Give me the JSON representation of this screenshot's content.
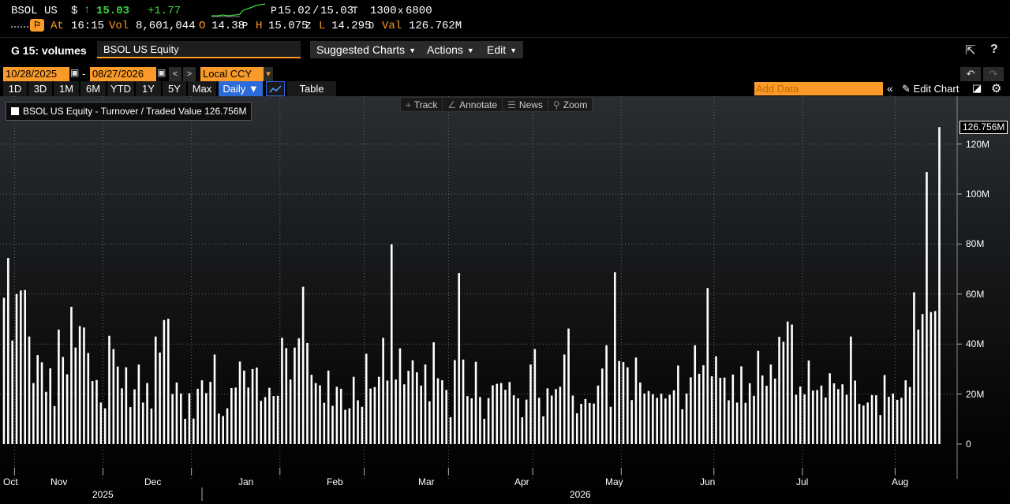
{
  "quote": {
    "ticker": "BSOL US",
    "currency": "$",
    "arrow": "↑",
    "last": "15.03",
    "change": "+1.77",
    "bid_prefix": "P",
    "bid": "15.02",
    "slash": "/",
    "ask": "15.03",
    "ask_suffix": "T",
    "size_bid": "1300",
    "size_x": "x",
    "size_ask": "6800",
    "at_label": "At",
    "time": "16:15",
    "vol_label": "Vol",
    "volume": "8,601,044",
    "open_label": "O",
    "open": "14.38",
    "open_suffix": "P",
    "high_label": "H",
    "high": "15.075",
    "high_suffix": "Z",
    "low_label": "L",
    "low": "14.295",
    "low_suffix": "D",
    "val_label": "Val",
    "value": "126.762M"
  },
  "toolbar": {
    "title": "G 15: volumes",
    "security": "BSOL US Equity",
    "suggested": "Suggested Charts",
    "actions": "Actions",
    "edit": "Edit"
  },
  "range": {
    "start": "10/28/2025",
    "dash": "-",
    "end": "08/27/2026",
    "currency": "Local CCY"
  },
  "periods": [
    "1D",
    "3D",
    "1M",
    "6M",
    "YTD",
    "1Y",
    "5Y",
    "Max"
  ],
  "frequency": "Daily ▼",
  "table_label": "Table",
  "add_data_placeholder": "Add Data",
  "edit_chart": "Edit Chart",
  "tools": {
    "track": "Track",
    "annotate": "Annotate",
    "news": "News",
    "zoom": "Zoom"
  },
  "legend_text": "BSOL US Equity - Turnover / Traded Value 126.756M",
  "last_value_label": "126.756M",
  "chart_data": {
    "type": "bar",
    "title": "",
    "series": [
      {
        "name": "BSOL US Equity - Turnover / Traded Value",
        "color": "#ffffff"
      }
    ],
    "y_ticks": [
      "0",
      "20M",
      "40M",
      "60M",
      "80M",
      "100M",
      "120M"
    ],
    "ylim": [
      0,
      130
    ],
    "y_unit": "M",
    "x_labels": [
      "Oct",
      "Nov",
      "Dec",
      "Jan",
      "Feb",
      "Mar",
      "Apr",
      "May",
      "Jun",
      "Jul",
      "Aug"
    ],
    "year_labels": [
      "2025",
      "2026"
    ],
    "grid": true,
    "values": [
      58.5,
      74.4,
      41.4,
      60,
      61.4,
      61.6,
      43,
      24.4,
      35.6,
      32.7,
      20.9,
      30.3,
      15.2,
      45.8,
      34.8,
      27.9,
      54.9,
      38.6,
      47.2,
      46.6,
      36.4,
      25.2,
      25.6,
      16.6,
      14.3,
      43.3,
      38,
      31,
      22.3,
      30.7,
      14.8,
      21.9,
      31.8,
      16.6,
      24.4,
      14.2,
      43,
      36.6,
      49.6,
      50.1,
      20,
      24.6,
      20.2,
      10.1,
      20.3,
      10.2,
      22.1,
      25.5,
      20.4,
      24.9,
      35.8,
      12.2,
      11.2,
      14.3,
      22.4,
      22.6,
      33,
      29.4,
      22.6,
      30,
      30.6,
      17.3,
      18.8,
      22.5,
      19.2,
      19.3,
      42.5,
      38.4,
      25.8,
      38.6,
      42.3,
      62.9,
      40.4,
      27.7,
      24.4,
      23.5,
      16.5,
      29.4,
      15.3,
      22.9,
      22.1,
      13.7,
      14.3,
      26.9,
      17.5,
      14.9,
      36.1,
      22.2,
      22.8,
      26.9,
      42.5,
      25.4,
      79.9,
      25.8,
      38.3,
      23.9,
      29.3,
      33.5,
      28.7,
      23.4,
      31.8,
      17.1,
      40.7,
      26.3,
      25.5,
      21.6,
      10.7,
      33.6,
      68.4,
      33.8,
      19.2,
      18.3,
      32.9,
      18.8,
      10.1,
      18.4,
      23.5,
      24.1,
      24.4,
      21.7,
      24.8,
      19.5,
      18.3,
      10.7,
      17.8,
      31.8,
      38,
      18.5,
      11.1,
      22.3,
      19.4,
      22,
      22.9,
      35.8,
      46.2,
      19.4,
      12.3,
      16.1,
      18,
      16.4,
      16.2,
      23.4,
      30.2,
      39.5,
      14.9,
      68.7,
      33.2,
      32.8,
      30.7,
      17.6,
      34.6,
      24.6,
      20.2,
      21.2,
      19.9,
      18.5,
      20.1,
      18.2,
      19.7,
      21.5,
      31.4,
      13.9,
      20.2,
      26.7,
      39.5,
      28.1,
      31.5,
      62.4,
      27.1,
      35.1,
      26.5,
      26.6,
      17.5,
      27.8,
      16.6,
      31.1,
      16.5,
      24.3,
      19.3,
      37.3,
      27.4,
      23.3,
      31.8,
      26.2,
      42.9,
      40.9,
      49,
      47.8,
      19.7,
      23,
      19.9,
      33.4,
      21.4,
      21.6,
      23.4,
      18.6,
      28.3,
      24.3,
      22,
      23.9,
      19.7,
      43,
      25.4,
      16.1,
      15.4,
      16.6,
      19.6,
      19.5,
      11.6,
      27.6,
      18.9,
      20.2,
      17.7,
      18.5,
      25.5,
      22.8,
      60.7,
      45.8,
      52,
      108.8,
      52.8,
      53.2,
      126.756
    ]
  }
}
